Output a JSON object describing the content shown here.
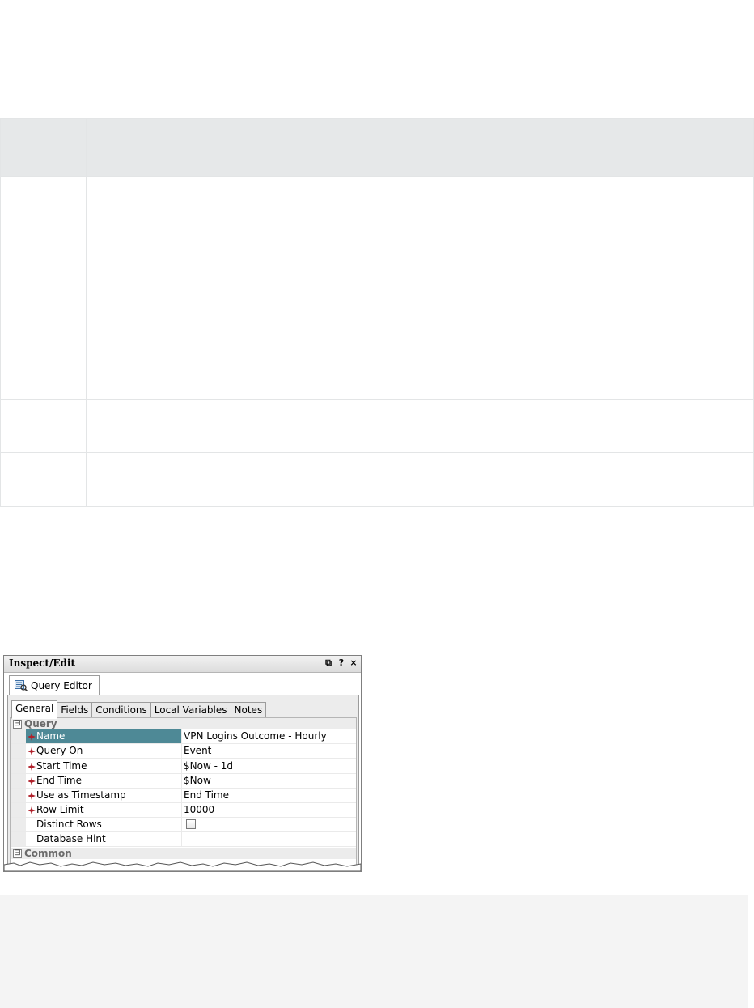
{
  "panel": {
    "title": "Inspect/Edit",
    "title_buttons": [
      {
        "icon": "restore-window-icon",
        "glyph": "⧉"
      },
      {
        "icon": "help-icon",
        "glyph": "?"
      },
      {
        "icon": "close-icon",
        "glyph": "×"
      }
    ],
    "outer_tab": {
      "label": "Query Editor",
      "icon": "query-editor-icon"
    },
    "tabs": [
      "General",
      "Fields",
      "Conditions",
      "Local Variables",
      "Notes"
    ],
    "active_tab": "General",
    "categories": [
      {
        "label": "Query",
        "expander": "⊟"
      },
      {
        "label": "Common",
        "expander": "⊟"
      }
    ],
    "properties": [
      {
        "name": "Name",
        "value": "VPN Logins Outcome - Hourly",
        "required": true,
        "selected": true
      },
      {
        "name": "Query On",
        "value": "Event",
        "required": true,
        "selected": false
      },
      {
        "name": "Start Time",
        "value": "$Now - 1d",
        "required": true,
        "selected": false
      },
      {
        "name": "End Time",
        "value": "$Now",
        "required": true,
        "selected": false
      },
      {
        "name": "Use as Timestamp",
        "value": "End Time",
        "required": true,
        "selected": false
      },
      {
        "name": "Row Limit",
        "value": "10000",
        "required": true,
        "selected": false
      },
      {
        "name": "Distinct Rows",
        "value": "",
        "required": false,
        "selected": false,
        "checkbox": true,
        "checked": false
      },
      {
        "name": "Database Hint",
        "value": "",
        "required": false,
        "selected": false
      }
    ]
  },
  "colors": {
    "selection": "#4e8996",
    "required_marker": "#b0202a",
    "table_header": "#e6e8e9",
    "bottom_block": "#f4f4f4"
  }
}
